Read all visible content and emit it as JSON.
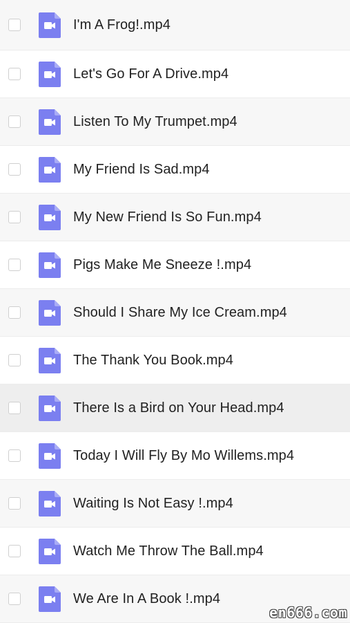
{
  "files": [
    {
      "name": "I'm A Frog!.mp4"
    },
    {
      "name": "Let's Go For A Drive.mp4"
    },
    {
      "name": "Listen To My Trumpet.mp4"
    },
    {
      "name": "My Friend Is Sad.mp4"
    },
    {
      "name": "My New Friend Is So Fun.mp4"
    },
    {
      "name": "Pigs Make Me Sneeze !.mp4"
    },
    {
      "name": "Should I Share My Ice Cream.mp4"
    },
    {
      "name": "The Thank You Book.mp4"
    },
    {
      "name": "There Is a Bird on Your Head.mp4"
    },
    {
      "name": "Today I Will Fly By Mo Willems.mp4"
    },
    {
      "name": "Waiting Is Not Easy !.mp4"
    },
    {
      "name": "Watch Me Throw The Ball.mp4"
    },
    {
      "name": "We Are In A Book !.mp4"
    }
  ],
  "colors": {
    "icon": "#7b7ff0",
    "icon_fold": "#a9acf6",
    "row_alt": "#f7f7f7",
    "row_hover": "#eeeeee"
  },
  "watermark": "en666.com"
}
